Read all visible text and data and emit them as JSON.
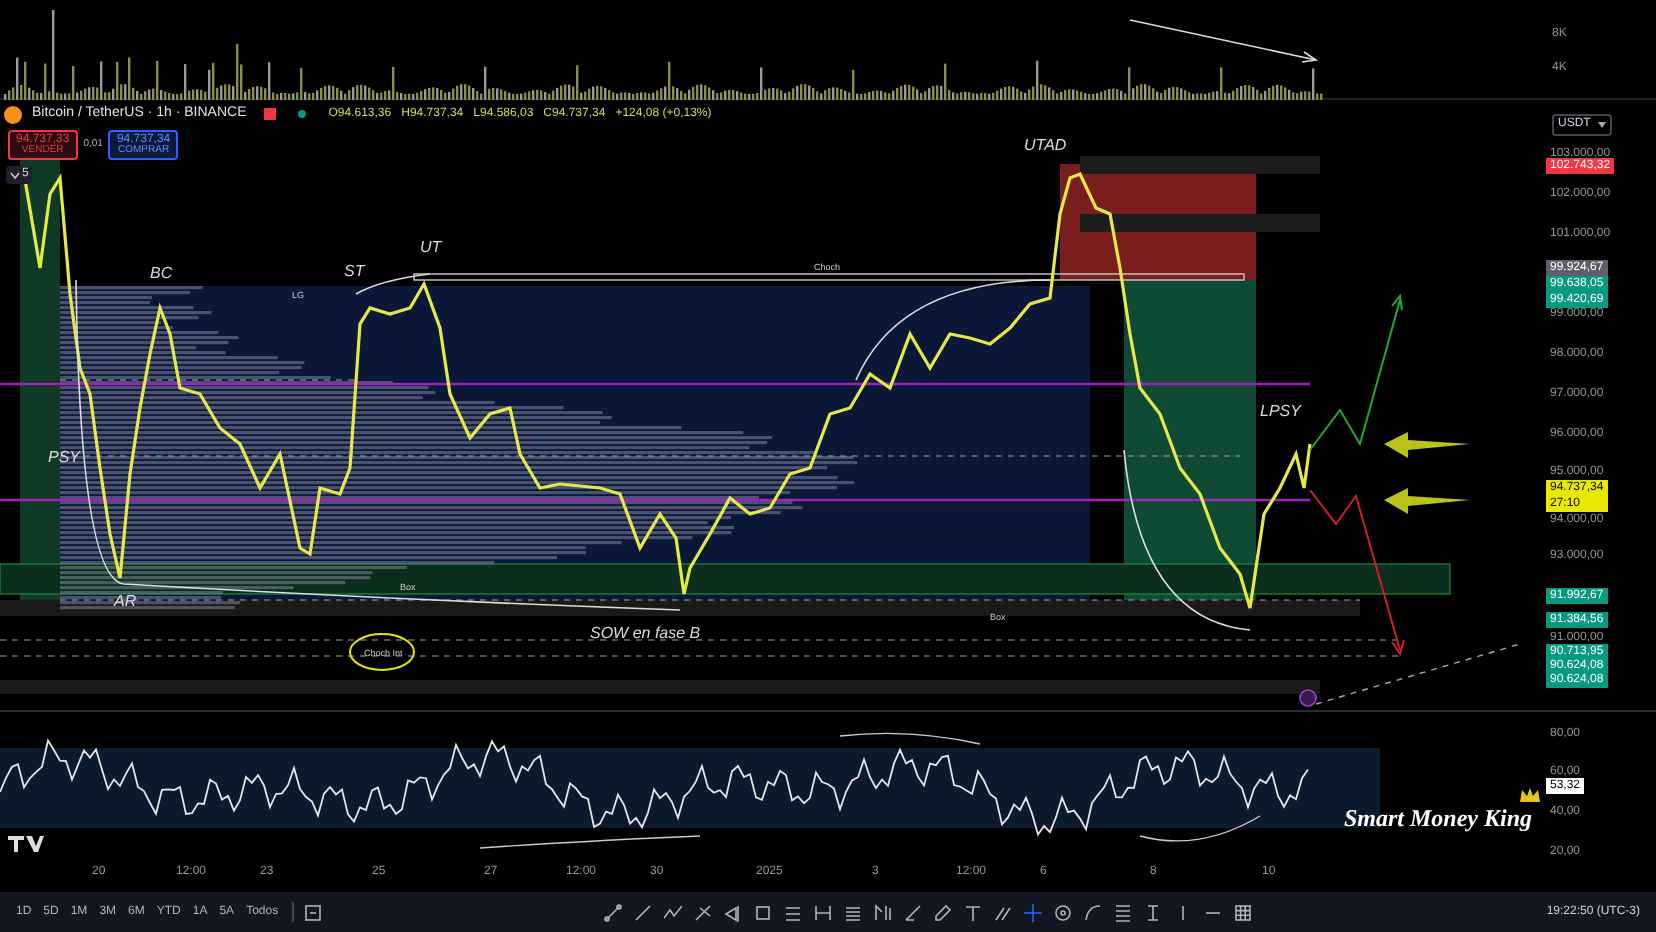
{
  "volume_axis": {
    "labels": [
      "8K",
      "4K"
    ]
  },
  "symbol_bar": {
    "title": "Bitcoin / TetherUS · 1h · BINANCE",
    "ohlc": [
      "O94.613,36",
      "H94.737,34",
      "L94.586,03",
      "C94.737,34",
      "+124,08 (+0,13%)"
    ]
  },
  "trade_buttons": {
    "sell": {
      "price": "94.737,33",
      "label": "VENDER"
    },
    "spread": "0,01",
    "buy": {
      "price": "94.737,34",
      "label": "COMPRAR"
    }
  },
  "indicators_toggle": "5",
  "currency": "USDT",
  "price_axis": {
    "items": [
      {
        "kind": "label",
        "text": "103.000,00"
      },
      {
        "kind": "badge",
        "text": "102.743,32",
        "color": "#f23645"
      },
      {
        "kind": "label",
        "text": "102.000,00"
      },
      {
        "kind": "label",
        "text": "101.000,00"
      },
      {
        "kind": "badge",
        "text": "99.924,67",
        "color": "#5d606b"
      },
      {
        "kind": "badge",
        "text": "99.638,05",
        "color": "#089981"
      },
      {
        "kind": "badge",
        "text": "99.420,69",
        "color": "#089981"
      },
      {
        "kind": "label",
        "text": "99.000,00"
      },
      {
        "kind": "label",
        "text": "98.000,00"
      },
      {
        "kind": "label",
        "text": "97.000,00"
      },
      {
        "kind": "label",
        "text": "96.000,00"
      },
      {
        "kind": "label",
        "text": "95.000,00"
      },
      {
        "kind": "badge",
        "text": "94.737,34",
        "subtext": "27:10",
        "color": "#e8e800"
      },
      {
        "kind": "label",
        "text": "94.000,00"
      },
      {
        "kind": "label",
        "text": "93.000,00"
      },
      {
        "kind": "badge",
        "text": "91.992,67",
        "color": "#089981"
      },
      {
        "kind": "badge",
        "text": "91.384,56",
        "color": "#089981"
      },
      {
        "kind": "label",
        "text": "91.000,00"
      },
      {
        "kind": "badge",
        "text": "90.713,95",
        "color": "#089981"
      },
      {
        "kind": "badge",
        "text": "90.624,08",
        "color": "#089981"
      },
      {
        "kind": "badge",
        "text": "90.624,08",
        "color": "#089981"
      }
    ]
  },
  "chart": {
    "annotations": [
      "PSY",
      "AR",
      "BC",
      "ST",
      "UT",
      "UTAD",
      "LPSY",
      "SOW en fase B"
    ],
    "zone_labels": [
      "Choch",
      "LG",
      "Box",
      "Box",
      "Choch Int"
    ]
  },
  "rsi": {
    "axis": [
      "80,00",
      "60,00",
      "40,00",
      "20,00"
    ],
    "value": "53,32"
  },
  "branding": "Smart Money King",
  "time_axis": [
    "20",
    "12:00",
    "23",
    "25",
    "27",
    "12:00",
    "30",
    "2025",
    "3",
    "12:00",
    "6",
    "8",
    "10"
  ],
  "toolbar": {
    "ranges": [
      "1D",
      "5D",
      "1M",
      "3M",
      "6M",
      "YTD",
      "1A",
      "5A",
      "Todos"
    ],
    "time": "19:22:50 (UTC-3)"
  }
}
